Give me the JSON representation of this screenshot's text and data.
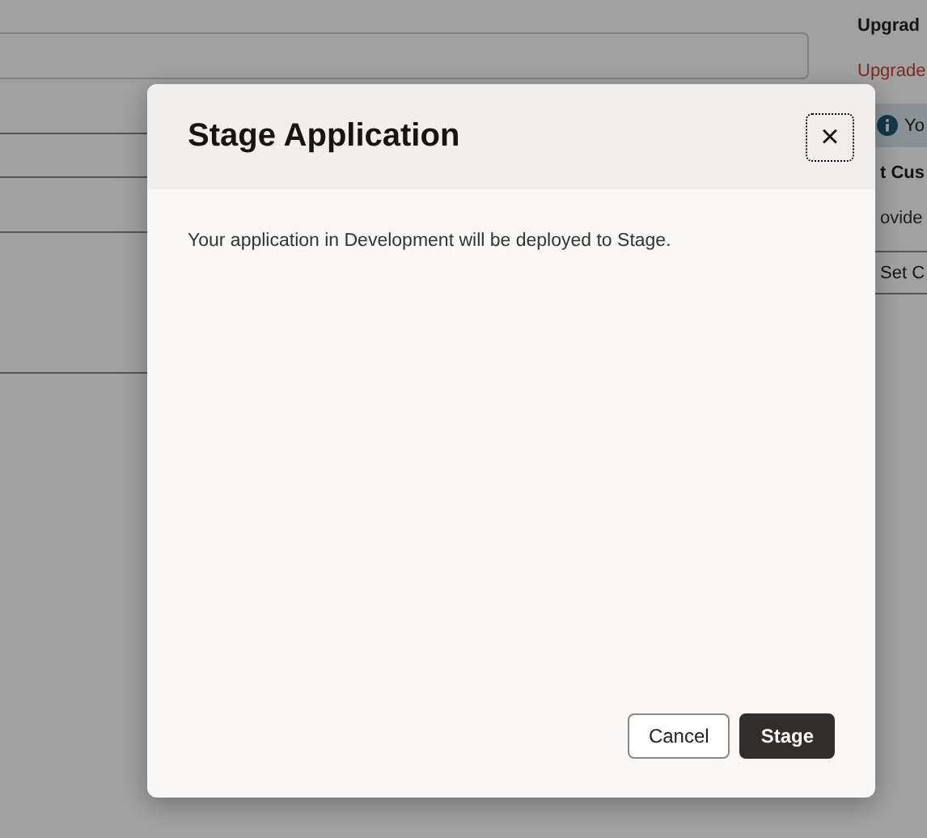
{
  "background": {
    "right": [
      {
        "kind": "heading",
        "text": "Upgrad"
      },
      {
        "kind": "link",
        "text": "Upgrade"
      },
      {
        "kind": "info",
        "text": "Yo"
      },
      {
        "kind": "heading",
        "text": "t Cus"
      },
      {
        "kind": "text",
        "text": "ovide"
      },
      {
        "kind": "button",
        "text": "Set C"
      }
    ]
  },
  "dialog": {
    "title": "Stage Application",
    "close_label": "×",
    "message": "Your application in Development will be deployed to Stage.",
    "buttons": [
      {
        "label": "Cancel",
        "kind": "secondary"
      },
      {
        "label": "Stage",
        "kind": "primary"
      }
    ]
  }
}
